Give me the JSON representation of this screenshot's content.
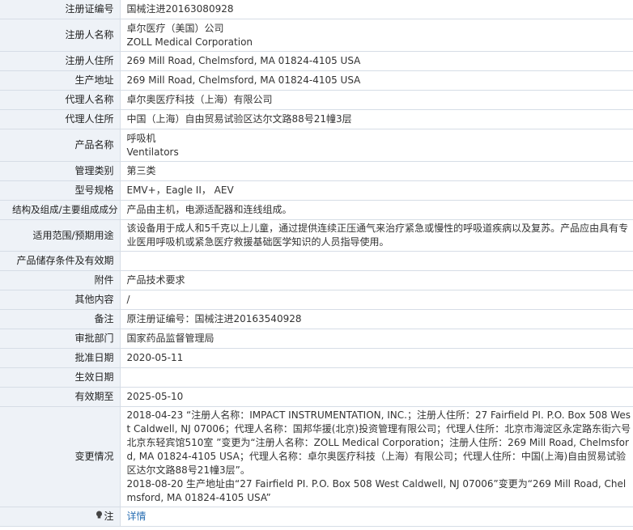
{
  "rows": [
    {
      "label": "注册证编号",
      "value": "国械注进20163080928"
    },
    {
      "label": "注册人名称",
      "value": "卓尔医疗（美国）公司\nZOLL Medical Corporation"
    },
    {
      "label": "注册人住所",
      "value": "269 Mill Road, Chelmsford, MA 01824-4105 USA"
    },
    {
      "label": "生产地址",
      "value": "269 Mill Road, Chelmsford, MA 01824-4105 USA"
    },
    {
      "label": "代理人名称",
      "value": "卓尔奥医疗科技（上海）有限公司"
    },
    {
      "label": "代理人住所",
      "value": "中国（上海）自由贸易试验区达尔文路88号21幢3层"
    },
    {
      "label": "产品名称",
      "value": "呼吸机\nVentilators"
    },
    {
      "label": "管理类别",
      "value": "第三类"
    },
    {
      "label": "型号规格",
      "value": "EMV+，Eagle II， AEV"
    },
    {
      "label": "结构及组成/主要组成成分",
      "value": "产品由主机，电源适配器和连线组成。"
    },
    {
      "label": "适用范围/预期用途",
      "value": "该设备用于成人和5千克以上儿童，通过提供连续正压通气来治疗紧急或慢性的呼吸道疾病以及复苏。产品应由具有专业医用呼吸机或紧急医疗救援基础医学知识的人员指导使用。"
    },
    {
      "label": "产品储存条件及有效期",
      "value": ""
    },
    {
      "label": "附件",
      "value": "产品技术要求"
    },
    {
      "label": "其他内容",
      "value": "/"
    },
    {
      "label": "备注",
      "value": "原注册证编号：国械注进20163540928"
    },
    {
      "label": "审批部门",
      "value": "国家药品监督管理局"
    },
    {
      "label": "批准日期",
      "value": "2020-05-11"
    },
    {
      "label": "生效日期",
      "value": ""
    },
    {
      "label": "有效期至",
      "value": "2025-05-10"
    },
    {
      "label": "变更情况",
      "value": "2018-04-23 “注册人名称：IMPACT INSTRUMENTATION, INC.；注册人住所：27 Fairfield PI. P.O. Box 508 West Caldwell, NJ 07006；代理人名称：国邦华援(北京)投资管理有限公司；代理人住所：北京市海淀区永定路东街六号北京东轻宾馆510室 ”变更为“注册人名称：ZOLL Medical Corporation；注册人住所：269 Mill Road, Chelmsford, MA 01824-4105 USA；代理人名称：卓尔奥医疗科技（上海）有限公司；代理人住所：中国(上海)自由贸易试验区达尔文路88号21幢3层”。\n2018-08-20 生产地址由“27 Fairfield PI. P.O. Box 508 West Caldwell, NJ 07006”变更为“269 Mill Road, Chelmsford, MA 01824-4105 USA”"
    }
  ],
  "note": {
    "label": "注",
    "icon": "lightbulb-icon",
    "link": "详情"
  },
  "colors": {
    "label_bg": "#eef2f7",
    "border": "#d6dde6",
    "link": "#2a6fb3"
  }
}
